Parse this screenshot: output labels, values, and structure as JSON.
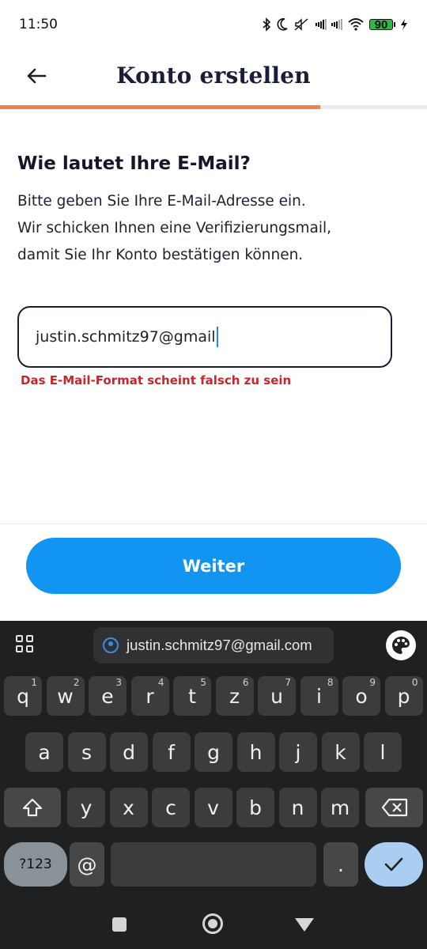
{
  "status_bar": {
    "time": "11:50",
    "battery": "90",
    "icons": [
      "bluetooth-icon",
      "moon-icon",
      "mute-icon",
      "signal-icon",
      "signal-icon",
      "wifi-icon",
      "battery-icon",
      "charging-icon"
    ]
  },
  "header": {
    "back_icon": "arrow-left-icon",
    "title": "Konto erstellen"
  },
  "progress": {
    "value": 0.75,
    "fill_color": "#ee7f4f"
  },
  "form": {
    "question": "Wie lautet Ihre E-Mail?",
    "description_lines": [
      "Bitte geben Sie Ihre E-Mail-Adresse ein.",
      "Wir schicken Ihnen eine Verifizierungsmail,",
      "damit Sie Ihr Konto bestätigen können."
    ],
    "email_value": "justin.schmitz97@gmail",
    "error": "Das E-Mail-Format scheint falsch zu sein"
  },
  "continue_button": {
    "label": "Weiter",
    "color": "#1294f2"
  },
  "keyboard": {
    "suggestion": "justin.schmitz97@gmail.com",
    "row1": [
      {
        "key": "q",
        "hint": "1"
      },
      {
        "key": "w",
        "hint": "2"
      },
      {
        "key": "e",
        "hint": "3"
      },
      {
        "key": "r",
        "hint": "4"
      },
      {
        "key": "t",
        "hint": "5"
      },
      {
        "key": "z",
        "hint": "6"
      },
      {
        "key": "u",
        "hint": "7"
      },
      {
        "key": "i",
        "hint": "8"
      },
      {
        "key": "o",
        "hint": "9"
      },
      {
        "key": "p",
        "hint": "0"
      }
    ],
    "row2": [
      "a",
      "s",
      "d",
      "f",
      "g",
      "h",
      "j",
      "k",
      "l"
    ],
    "row3": [
      "y",
      "x",
      "c",
      "v",
      "b",
      "n",
      "m"
    ],
    "symbols_label": "?123",
    "at_label": "@",
    "period_label": "."
  }
}
